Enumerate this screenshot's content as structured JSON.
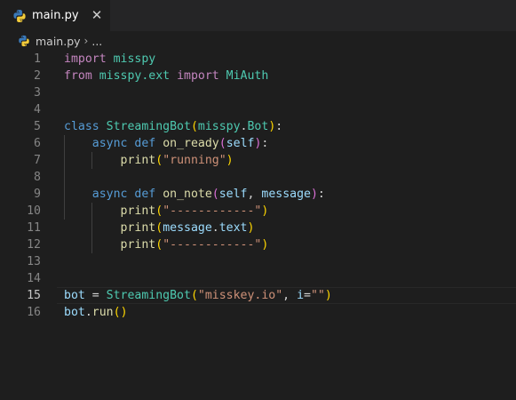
{
  "tab": {
    "filename": "main.py",
    "close_glyph": "✕"
  },
  "breadcrumb": {
    "file": "main.py",
    "separator": "›",
    "more": "..."
  },
  "editor": {
    "current_line": 15,
    "lines": [
      {
        "num": "1",
        "tokens": [
          [
            "kw-ctrl",
            "import"
          ],
          [
            "op",
            " "
          ],
          [
            "cls",
            "misspy"
          ]
        ]
      },
      {
        "num": "2",
        "tokens": [
          [
            "kw-ctrl",
            "from"
          ],
          [
            "op",
            " "
          ],
          [
            "cls",
            "misspy.ext"
          ],
          [
            "op",
            " "
          ],
          [
            "kw-ctrl",
            "import"
          ],
          [
            "op",
            " "
          ],
          [
            "cls",
            "MiAuth"
          ]
        ]
      },
      {
        "num": "3",
        "tokens": []
      },
      {
        "num": "4",
        "tokens": []
      },
      {
        "num": "5",
        "tokens": [
          [
            "kw",
            "class"
          ],
          [
            "op",
            " "
          ],
          [
            "cls",
            "StreamingBot"
          ],
          [
            "pn",
            "("
          ],
          [
            "cls",
            "misspy"
          ],
          [
            "op",
            "."
          ],
          [
            "cls",
            "Bot"
          ],
          [
            "pn",
            ")"
          ],
          [
            "op",
            ":"
          ]
        ]
      },
      {
        "num": "6",
        "tokens": [
          [
            "op",
            "    "
          ],
          [
            "kw",
            "async"
          ],
          [
            "op",
            " "
          ],
          [
            "kw",
            "def"
          ],
          [
            "op",
            " "
          ],
          [
            "fn",
            "on_ready"
          ],
          [
            "pn2",
            "("
          ],
          [
            "var",
            "self"
          ],
          [
            "pn2",
            ")"
          ],
          [
            "op",
            ":"
          ]
        ]
      },
      {
        "num": "7",
        "tokens": [
          [
            "op",
            "        "
          ],
          [
            "fn",
            "print"
          ],
          [
            "pn",
            "("
          ],
          [
            "str",
            "\"running\""
          ],
          [
            "pn",
            ")"
          ]
        ]
      },
      {
        "num": "8",
        "tokens": []
      },
      {
        "num": "9",
        "tokens": [
          [
            "op",
            "    "
          ],
          [
            "kw",
            "async"
          ],
          [
            "op",
            " "
          ],
          [
            "kw",
            "def"
          ],
          [
            "op",
            " "
          ],
          [
            "fn",
            "on_note"
          ],
          [
            "pn2",
            "("
          ],
          [
            "var",
            "self"
          ],
          [
            "op",
            ", "
          ],
          [
            "var",
            "message"
          ],
          [
            "pn2",
            ")"
          ],
          [
            "op",
            ":"
          ]
        ]
      },
      {
        "num": "10",
        "tokens": [
          [
            "op",
            "        "
          ],
          [
            "fn",
            "print"
          ],
          [
            "pn",
            "("
          ],
          [
            "str",
            "\"------------\""
          ],
          [
            "pn",
            ")"
          ]
        ]
      },
      {
        "num": "11",
        "tokens": [
          [
            "op",
            "        "
          ],
          [
            "fn",
            "print"
          ],
          [
            "pn",
            "("
          ],
          [
            "var",
            "message"
          ],
          [
            "op",
            "."
          ],
          [
            "var",
            "text"
          ],
          [
            "pn",
            ")"
          ]
        ]
      },
      {
        "num": "12",
        "tokens": [
          [
            "op",
            "        "
          ],
          [
            "fn",
            "print"
          ],
          [
            "pn",
            "("
          ],
          [
            "str",
            "\"------------\""
          ],
          [
            "pn",
            ")"
          ]
        ]
      },
      {
        "num": "13",
        "tokens": []
      },
      {
        "num": "14",
        "tokens": []
      },
      {
        "num": "15",
        "tokens": [
          [
            "var",
            "bot"
          ],
          [
            "op",
            " = "
          ],
          [
            "cls",
            "StreamingBot"
          ],
          [
            "pn",
            "("
          ],
          [
            "str",
            "\"misskey.io\""
          ],
          [
            "op",
            ", "
          ],
          [
            "var",
            "i"
          ],
          [
            "op",
            "="
          ],
          [
            "str",
            "\"\""
          ],
          [
            "pn",
            ")"
          ]
        ]
      },
      {
        "num": "16",
        "tokens": [
          [
            "var",
            "bot"
          ],
          [
            "op",
            "."
          ],
          [
            "fn",
            "run"
          ],
          [
            "pn",
            "("
          ],
          [
            "pn",
            ")"
          ]
        ]
      }
    ]
  }
}
